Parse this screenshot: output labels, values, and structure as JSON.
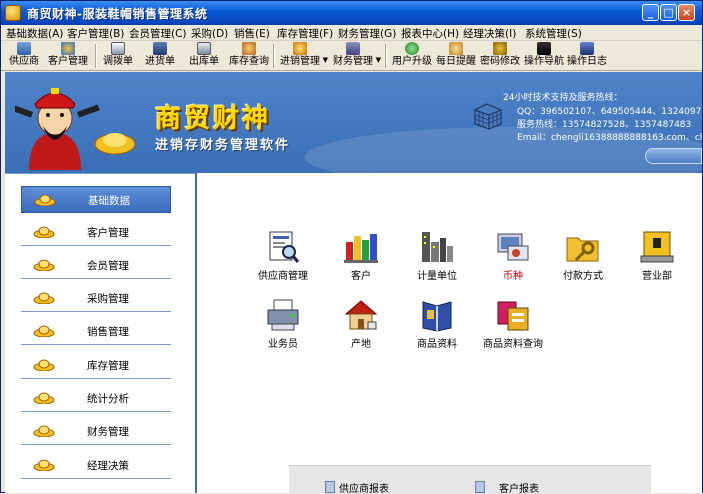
{
  "window": {
    "title": "商贸财神-服装鞋帽销售管理系统",
    "minimize": "_",
    "maximize": "□",
    "close": "×"
  },
  "menu": [
    "基础数据(A)",
    "客户管理(B)",
    "会员管理(C)",
    "采购(D)",
    "销售(E)",
    "库存管理(F)",
    "财务管理(G)",
    "报表中心(H)",
    "经理决策(I)",
    "系统管理(S)"
  ],
  "toolbar": [
    {
      "label": "供应商",
      "icon": "supplier-icon"
    },
    {
      "label": "客户管理",
      "icon": "customer-icon"
    },
    {
      "label": "调拨单",
      "icon": "transfer-icon"
    },
    {
      "label": "进货单",
      "icon": "purchase-order-icon"
    },
    {
      "label": "出库单",
      "icon": "outbound-order-icon"
    },
    {
      "label": "库存查询",
      "icon": "inventory-query-icon"
    },
    {
      "label": "进销管理",
      "icon": "sales-purchase-icon"
    },
    {
      "label": "财务管理",
      "icon": "finance-icon"
    },
    {
      "label": "用户升级",
      "icon": "upgrade-icon"
    },
    {
      "label": "每日提醒",
      "icon": "reminder-icon"
    },
    {
      "label": "密码修改",
      "icon": "password-icon"
    },
    {
      "label": "操作导航",
      "icon": "navigation-icon"
    },
    {
      "label": "操作日志",
      "icon": "log-icon"
    }
  ],
  "banner": {
    "brand": "商贸财神",
    "slogan": "进销存财务管理软件",
    "support_title": "24小时技术支持及服务热线：",
    "qq": "QQ：396502107、649505444、1324097",
    "hotline": "服务热线：13574827528、1357487483",
    "email": "Email：chengli16388888888163.com、chen"
  },
  "sidebar": [
    {
      "label": "基础数据",
      "active": true
    },
    {
      "label": "客户管理",
      "active": false
    },
    {
      "label": "会员管理",
      "active": false
    },
    {
      "label": "采购管理",
      "active": false
    },
    {
      "label": "销售管理",
      "active": false
    },
    {
      "label": "库存管理",
      "active": false
    },
    {
      "label": "统计分析",
      "active": false
    },
    {
      "label": "财务管理",
      "active": false
    },
    {
      "label": "经理决策",
      "active": false
    }
  ],
  "modules": [
    {
      "label": "供应商管理",
      "icon": "supplier-management-icon"
    },
    {
      "label": "客户",
      "icon": "customer-chart-icon"
    },
    {
      "label": "计量单位",
      "icon": "city-building-icon"
    },
    {
      "label": "币种",
      "icon": "currency-icon",
      "highlight_color": "#c00000"
    },
    {
      "label": "付款方式",
      "icon": "folder-key-icon"
    },
    {
      "label": "营业部",
      "icon": "briefcase-icon"
    },
    {
      "label": "业务员",
      "icon": "printer-icon"
    },
    {
      "label": "产地",
      "icon": "house-icon"
    },
    {
      "label": "商品资料",
      "icon": "book-icon"
    },
    {
      "label": "商品资料查询",
      "icon": "product-query-icon"
    }
  ],
  "reports": [
    "供应商报表",
    "客户报表"
  ],
  "colors": {
    "titlebar": "#0b5bd8",
    "banner": "#4f84c9",
    "brand_gold": "#ffd800",
    "sidebar_active": "#3a6bbf"
  }
}
